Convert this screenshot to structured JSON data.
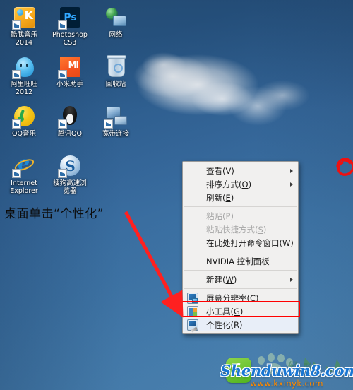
{
  "desktop": {
    "icons": [
      {
        "label": "酷我音乐\n2014",
        "art": "art-kuwo",
        "name": "desktop-icon-kuwo-music",
        "shortcut": true
      },
      {
        "label": "Photoshop\nCS3",
        "art": "art-ps",
        "name": "desktop-icon-photoshop-cs3",
        "shortcut": true
      },
      {
        "label": "网络",
        "art": "art-network",
        "name": "desktop-icon-network",
        "shortcut": false
      },
      {
        "label": "阿里旺旺\n2012",
        "art": "art-wangwang",
        "name": "desktop-icon-aliwangwang",
        "shortcut": true
      },
      {
        "label": "小米助手",
        "art": "art-xiaomi",
        "name": "desktop-icon-xiaomi-assistant",
        "shortcut": true
      },
      {
        "label": "回收站",
        "art": "art-recycle",
        "name": "desktop-icon-recycle-bin",
        "shortcut": false
      },
      {
        "label": "QQ音乐",
        "art": "art-qqmusic",
        "name": "desktop-icon-qq-music",
        "shortcut": true
      },
      {
        "label": "腾讯QQ",
        "art": "art-qq",
        "name": "desktop-icon-tencent-qq",
        "shortcut": true
      },
      {
        "label": "宽带连接",
        "art": "art-broadband",
        "name": "desktop-icon-broadband-connection",
        "shortcut": true
      },
      {
        "label": "Internet\nExplorer",
        "art": "art-ie",
        "name": "desktop-icon-internet-explorer",
        "shortcut": true
      },
      {
        "label": "搜狗高速浏\n览器",
        "art": "art-sogou",
        "name": "desktop-icon-sogou-browser",
        "shortcut": true
      }
    ]
  },
  "annotation": {
    "text": "桌面单击“个性化”",
    "arrow_color": "#ff2020",
    "text_color": "#0c0c0c"
  },
  "context_menu": {
    "groups": [
      {
        "items": [
          {
            "label": "查看(V)",
            "accel": "V",
            "icon": null,
            "disabled": false,
            "submenu": true,
            "name": "menu-item-view"
          },
          {
            "label": "排序方式(O)",
            "accel": "O",
            "icon": null,
            "disabled": false,
            "submenu": true,
            "name": "menu-item-sort-by"
          },
          {
            "label": "刷新(E)",
            "accel": "E",
            "icon": null,
            "disabled": false,
            "submenu": false,
            "name": "menu-item-refresh"
          }
        ]
      },
      {
        "items": [
          {
            "label": "粘贴(P)",
            "accel": "P",
            "icon": null,
            "disabled": true,
            "submenu": false,
            "name": "menu-item-paste"
          },
          {
            "label": "粘贴快捷方式(S)",
            "accel": "S",
            "icon": null,
            "disabled": true,
            "submenu": false,
            "name": "menu-item-paste-shortcut"
          },
          {
            "label": "在此处打开命令窗口(W)",
            "accel": "W",
            "icon": null,
            "disabled": false,
            "submenu": false,
            "name": "menu-item-open-command-window-here"
          }
        ]
      },
      {
        "items": [
          {
            "label": "NVIDIA 控制面板",
            "accel": "",
            "icon": null,
            "disabled": false,
            "submenu": false,
            "name": "menu-item-nvidia-control-panel"
          }
        ]
      },
      {
        "items": [
          {
            "label": "新建(W)",
            "accel": "W",
            "icon": null,
            "disabled": false,
            "submenu": true,
            "name": "menu-item-new"
          }
        ]
      },
      {
        "items": [
          {
            "label": "屏幕分辨率(C)",
            "accel": "C",
            "icon": "mi-monitor",
            "disabled": false,
            "submenu": false,
            "name": "menu-item-screen-resolution"
          },
          {
            "label": "小工具(G)",
            "accel": "G",
            "icon": "mi-gadget",
            "disabled": false,
            "submenu": false,
            "name": "menu-item-gadgets"
          },
          {
            "label": "个性化(R)",
            "accel": "R",
            "icon": "mi-personalize",
            "disabled": false,
            "submenu": false,
            "name": "menu-item-personalize",
            "highlighted": true
          }
        ]
      }
    ],
    "highlight_color": "#ff0000"
  },
  "watermark": {
    "main": "Shenduwin8.com",
    "sub": "www.kxinyk.com",
    "main_color": "#1976d2",
    "sub_color": "#ff8a00"
  }
}
